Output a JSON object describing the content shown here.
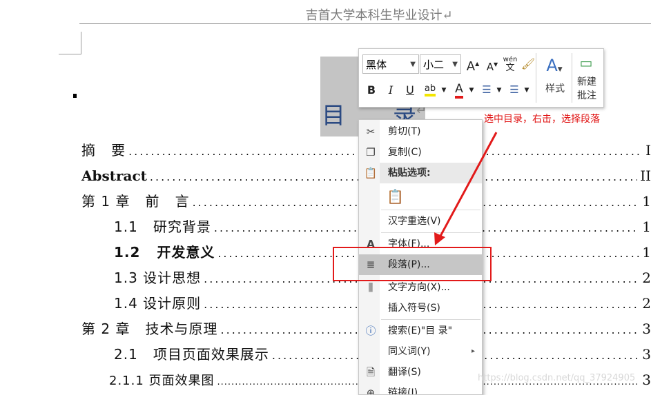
{
  "header": {
    "text": "吉首大学本科生毕业设计↵"
  },
  "title": {
    "char1": "目",
    "char2": "录",
    "mark": "↵"
  },
  "toc": [
    {
      "label": "摘   要",
      "page": "I"
    },
    {
      "label": "Abstract",
      "page": "II"
    },
    {
      "label": "第 1 章   前   言",
      "page": "1"
    },
    {
      "label": "1.1   研究背景",
      "page": "1"
    },
    {
      "label": "1.2   开发意义",
      "page": "1"
    },
    {
      "label": "1.3 设计思想",
      "page": "2"
    },
    {
      "label": "1.4 设计原则",
      "page": "2"
    },
    {
      "label": "第 2 章   技术与原理",
      "page": "3"
    },
    {
      "label": "2.1   项目页面效果展示",
      "page": "3"
    },
    {
      "label": "2.1.1 页面效果图",
      "page": "3"
    }
  ],
  "mini_toolbar": {
    "font_name": "黑体",
    "font_size": "小二",
    "grow_font": "A",
    "shrink_font": "A",
    "phonetic": "wén",
    "bold": "B",
    "italic": "I",
    "underline": "U",
    "highlight": "ab",
    "font_color": "A",
    "styles_label": "样式",
    "new_comment_label": [
      "新建",
      "批注"
    ]
  },
  "context_menu": {
    "items": [
      {
        "label": "剪切(T)",
        "icon": "scissors-icon"
      },
      {
        "label": "复制(C)",
        "icon": "copy-icon"
      },
      {
        "label": "粘贴选项:",
        "icon": "paste-icon"
      },
      {
        "label": "汉字重选(V)",
        "icon": ""
      },
      {
        "label": "字体(F)...",
        "icon": "font-icon"
      },
      {
        "label": "段落(P)...",
        "icon": "paragraph-icon"
      },
      {
        "label": "文字方向(X)...",
        "icon": "text-direction-icon"
      },
      {
        "label": "插入符号(S)",
        "icon": ""
      },
      {
        "label": "搜索(E)\"目   录\"",
        "icon": "search-icon"
      },
      {
        "label": "同义词(Y)",
        "icon": "",
        "submenu": "▸"
      },
      {
        "label": "翻译(S)",
        "icon": "translate-icon"
      },
      {
        "label": "链接(I)",
        "icon": "link-icon"
      }
    ]
  },
  "annotation": {
    "text": "选中目录，右击，选择段落",
    "color": "#e01010"
  },
  "watermark": "https://blog.csdn.net/qq_37924905",
  "colors": {
    "title_blue": "#2b4a82",
    "selection_gray": "#c4c4c4",
    "annotation_red": "#e21a1a"
  }
}
